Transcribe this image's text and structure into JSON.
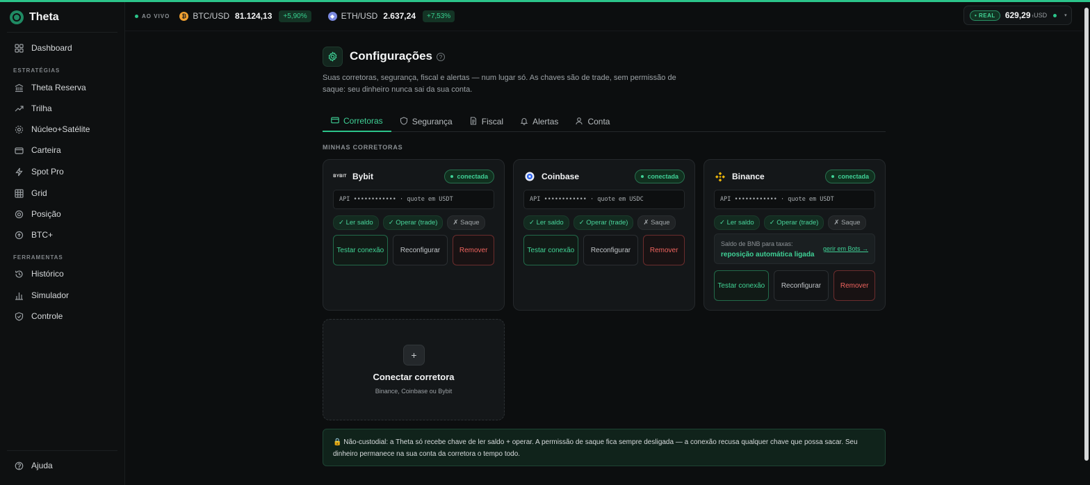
{
  "app": {
    "name": "Theta"
  },
  "sidebar": {
    "dashboard": "Dashboard",
    "group_strategies": "ESTRATÉGIAS",
    "strategies": [
      "Theta Reserva",
      "Trilha",
      "Núcleo+Satélite",
      "Carteira",
      "Spot Pro",
      "Grid",
      "Posição",
      "BTC+"
    ],
    "group_tools": "FERRAMENTAS",
    "tools": [
      "Histórico",
      "Simulador",
      "Controle"
    ],
    "help": "Ajuda"
  },
  "header": {
    "live_label": "AO VIVO",
    "tickers": [
      {
        "pair": "BTC/USD",
        "price": "81.124,13",
        "change": "+5,90%",
        "coin": "btc-icon"
      },
      {
        "pair": "ETH/USD",
        "price": "2.637,24",
        "change": "+7,53%",
        "coin": "eth-icon"
      }
    ],
    "wallet": {
      "mode": "• REAL",
      "amount": "629,29",
      "currency": "ₜUSD"
    }
  },
  "page": {
    "title": "Configurações",
    "subtitle": "Suas corretoras, segurança, fiscal e alertas — num lugar só. As chaves são de trade, sem permissão de saque: seu dinheiro nunca sai da sua conta.",
    "tabs": [
      "Corretoras",
      "Segurança",
      "Fiscal",
      "Alertas",
      "Conta"
    ],
    "active_tab": "Corretoras",
    "section_label": "MINHAS CORRETORAS"
  },
  "brokers": [
    {
      "name": "Bybit",
      "status": "conectada",
      "api": "API •••••••••••• · quote em USDT",
      "perms": [
        "✓ Ler saldo",
        "✓ Operar (trade)",
        "✗ Saque"
      ],
      "buttons": {
        "test": "Testar conexão",
        "reconfigure": "Reconfigurar",
        "remove": "Remover"
      }
    },
    {
      "name": "Coinbase",
      "status": "conectada",
      "api": "API •••••••••••• · quote em USDC",
      "perms": [
        "✓ Ler saldo",
        "✓ Operar (trade)",
        "✗ Saque"
      ],
      "buttons": {
        "test": "Testar conexão",
        "reconfigure": "Reconfigurar",
        "remove": "Remover"
      }
    },
    {
      "name": "Binance",
      "status": "conectada",
      "api": "API •••••••••••• · quote em USDT",
      "perms": [
        "✓ Ler saldo",
        "✓ Operar (trade)",
        "✗ Saque"
      ],
      "bnb": {
        "label": "Saldo de BNB para taxas:",
        "value": "reposição automática ligada",
        "link": "gerir em Bots →"
      },
      "buttons": {
        "test": "Testar conexão",
        "reconfigure": "Reconfigurar",
        "remove": "Remover"
      }
    }
  ],
  "add_broker": {
    "plus": "+",
    "title": "Conectar corretora",
    "subtitle": "Binance, Coinbase ou Bybit"
  },
  "notice": {
    "icon": "lock-icon",
    "text": "Não-custodial: a Theta só recebe chave de ler saldo + operar. A permissão de saque fica sempre desligada — a conexão recusa qualquer chave que possa sacar. Seu dinheiro permanece na sua conta da corretora o tempo todo."
  },
  "colors": {
    "accent": "#2bc48a",
    "danger": "#f0645f",
    "background": "#0c0e0f"
  }
}
